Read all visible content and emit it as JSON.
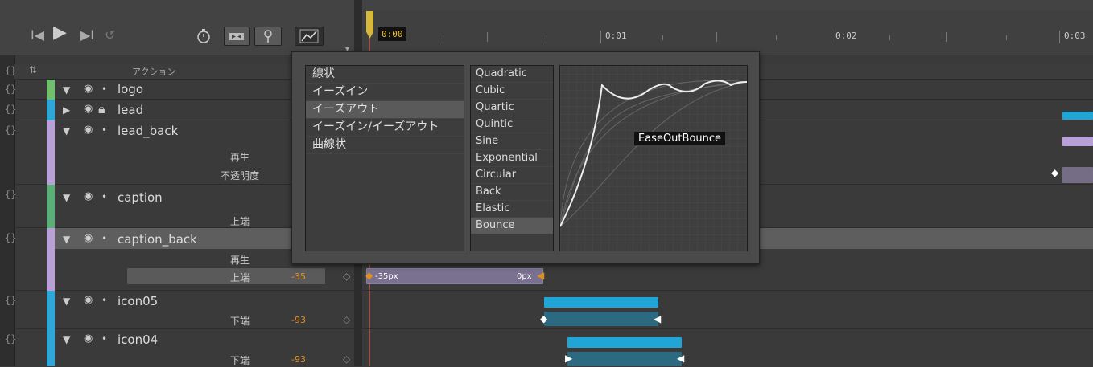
{
  "controls": {
    "transport": [
      "I◀",
      "▶",
      "▶I",
      "↺"
    ],
    "toolbar_icons": [
      "stopwatch-icon",
      "transition-icon",
      "pin-icon",
      "easing-graph-icon"
    ]
  },
  "timeline": {
    "times": [
      "0:00",
      "0:01",
      "0:02",
      "0:03"
    ],
    "current_time": "0:00"
  },
  "header": {
    "braces": "{}",
    "sort_icon": "sort-icon",
    "action_label": "アクション"
  },
  "layers": [
    {
      "name": "logo",
      "color": "#6fbf6f",
      "locked": false,
      "expanded": true
    },
    {
      "name": "lead",
      "color": "#2ea6d8",
      "locked": true,
      "expanded": false
    },
    {
      "name": "lead_back",
      "color": "#b9a1d8",
      "locked": false,
      "expanded": true
    },
    {
      "name": "caption",
      "color": "#5cae78",
      "locked": false,
      "expanded": true
    },
    {
      "name": "caption_back",
      "color": "#b9a1d8",
      "locked": false,
      "expanded": true
    },
    {
      "name": "icon05",
      "color": "#2ea6d8",
      "locked": false,
      "expanded": true
    },
    {
      "name": "icon04",
      "color": "#2ea6d8",
      "locked": false,
      "expanded": true
    }
  ],
  "properties": {
    "lead_back_play": "再生",
    "lead_back_opacity": "不透明度",
    "caption_top": "上端",
    "caption_back_play": "再生",
    "caption_back_top": "上端",
    "caption_back_top_value": "-35",
    "icon05_bottom": "下端",
    "icon05_bottom_value": "-93",
    "icon04_bottom": "下端",
    "icon04_bottom_value": "-93"
  },
  "keyframe_labels": {
    "start": "-35px",
    "end": "0px"
  },
  "easing_popup": {
    "types": [
      "線状",
      "イーズイン",
      "イーズアウト",
      "イーズイン/イーズアウト",
      "曲線状"
    ],
    "selected_type": "イーズアウト",
    "functions": [
      "Quadratic",
      "Cubic",
      "Quartic",
      "Quintic",
      "Sine",
      "Exponential",
      "Circular",
      "Back",
      "Elastic",
      "Bounce"
    ],
    "selected_function": "Bounce",
    "graph_label": "EaseOutBounce"
  },
  "colors": {
    "accent_orange": "#e09020",
    "bar_blue": "#1fa5d6",
    "bar_purple": "#b9a1d8"
  }
}
